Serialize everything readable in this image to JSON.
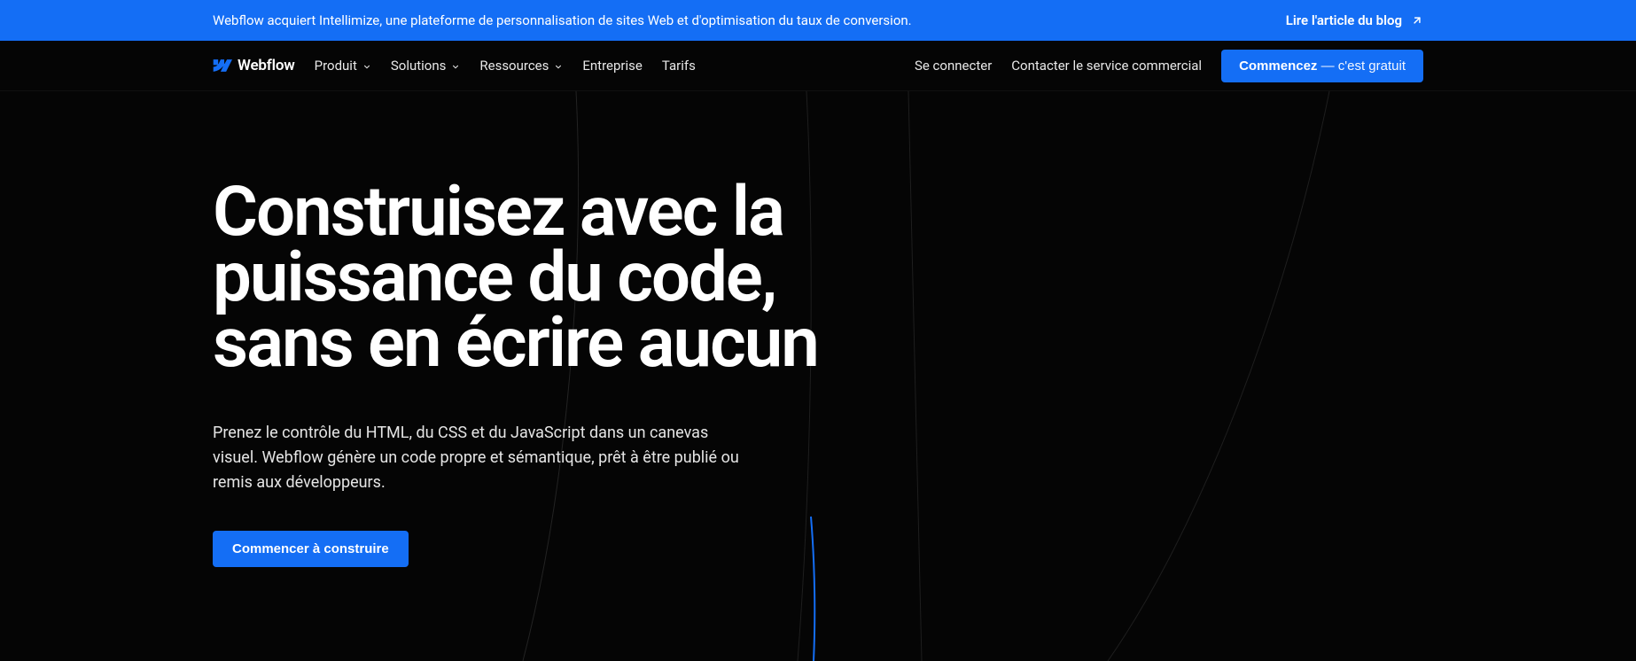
{
  "banner": {
    "text": "Webflow acquiert Intellimize, une plateforme de personnalisation de sites Web et d'optimisation du taux de conversion.",
    "link_label": "Lire l'article du blog"
  },
  "nav": {
    "logo_text": "Webflow",
    "items": [
      {
        "label": "Produit",
        "dropdown": true
      },
      {
        "label": "Solutions",
        "dropdown": true
      },
      {
        "label": "Ressources",
        "dropdown": true
      },
      {
        "label": "Entreprise",
        "dropdown": false
      },
      {
        "label": "Tarifs",
        "dropdown": false
      }
    ],
    "right_links": [
      {
        "label": "Se connecter"
      },
      {
        "label": "Contacter le service commercial"
      }
    ],
    "cta_primary": "Commencez",
    "cta_secondary": " — c'est gratuit"
  },
  "hero": {
    "title": "Construisez avec la puissance du code, sans en écrire aucun",
    "subtitle": "Prenez le contrôle du HTML, du CSS et du JavaScript dans un canevas visuel. Webflow génère un code propre et sémantique, prêt à être publié ou remis aux développeurs.",
    "cta": "Commencer à construire"
  },
  "colors": {
    "brand": "#146ef5",
    "bg": "#050505"
  }
}
